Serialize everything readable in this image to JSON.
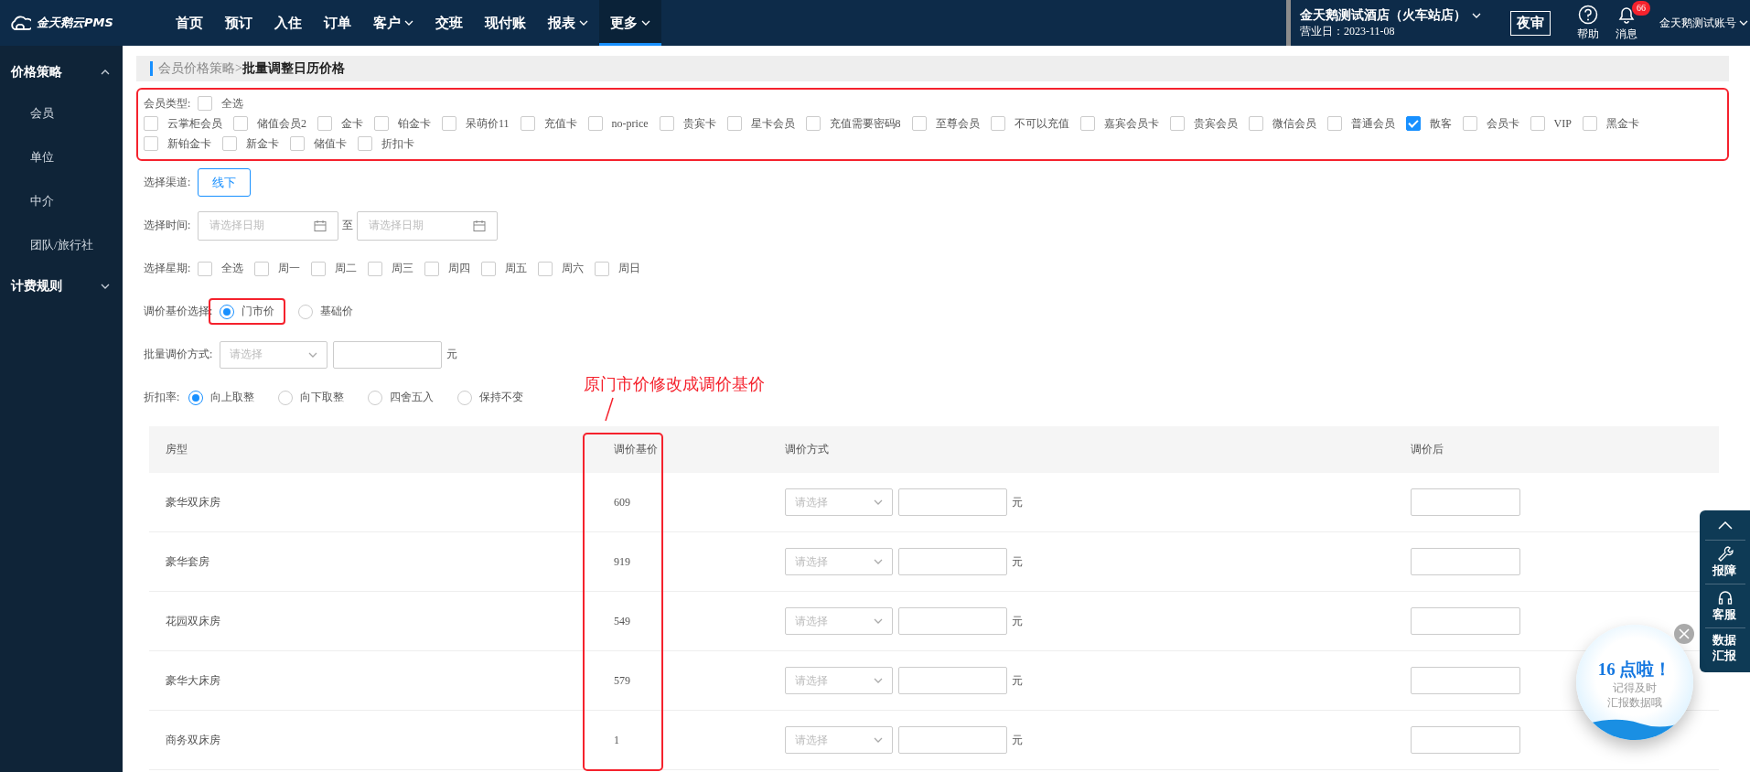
{
  "top_bar": {
    "logo": "金天鹅云PMS",
    "nav": [
      {
        "label": "首页",
        "dropdown": false,
        "selected": false
      },
      {
        "label": "预订",
        "dropdown": false,
        "selected": false
      },
      {
        "label": "入住",
        "dropdown": false,
        "selected": false
      },
      {
        "label": "订单",
        "dropdown": false,
        "selected": false
      },
      {
        "label": "客户",
        "dropdown": true,
        "selected": false
      },
      {
        "label": "交班",
        "dropdown": false,
        "selected": false
      },
      {
        "label": "现付账",
        "dropdown": false,
        "selected": false
      },
      {
        "label": "报表",
        "dropdown": true,
        "selected": false
      },
      {
        "label": "更多",
        "dropdown": true,
        "selected": true
      }
    ],
    "hotel": {
      "name": "金天鹅测试酒店（火车站店）",
      "business_date": "营业日：2023-11-08"
    },
    "night_audit": "夜审",
    "help": "帮助",
    "messages": {
      "label": "消息",
      "badge": "66"
    },
    "account": "金天鹅测试账号"
  },
  "sidebar": {
    "items": [
      {
        "label": "价格策略",
        "expanded": true,
        "children": [
          {
            "label": "会员"
          },
          {
            "label": "单位"
          },
          {
            "label": "中介"
          },
          {
            "label": "团队/旅行社"
          }
        ]
      },
      {
        "label": "计费规则",
        "expanded": false
      }
    ]
  },
  "breadcrumb": {
    "parent": "会员价格策略>",
    "current": "批量调整日历价格"
  },
  "member_types": {
    "label": "会员类型:",
    "highlighted": true,
    "select_all": {
      "label": "全选",
      "checked": false
    },
    "options": [
      {
        "label": "云掌柜会员",
        "checked": false
      },
      {
        "label": "储值会员2",
        "checked": false
      },
      {
        "label": "金卡",
        "checked": false
      },
      {
        "label": "铂金卡",
        "checked": false
      },
      {
        "label": "呆萌价11",
        "checked": false
      },
      {
        "label": "充值卡",
        "checked": false
      },
      {
        "label": "no-price",
        "checked": false
      },
      {
        "label": "贵宾卡",
        "checked": false
      },
      {
        "label": "星卡会员",
        "checked": false
      },
      {
        "label": "充值需要密码8",
        "checked": false
      },
      {
        "label": "至尊会员",
        "checked": false
      },
      {
        "label": "不可以充值",
        "checked": false
      },
      {
        "label": "嘉宾会员卡",
        "checked": false
      },
      {
        "label": "贵宾会员",
        "checked": false
      },
      {
        "label": "微信会员",
        "checked": false
      },
      {
        "label": "普通会员",
        "checked": false
      },
      {
        "label": "散客",
        "checked": true
      },
      {
        "label": "会员卡",
        "checked": false
      },
      {
        "label": "VIP",
        "checked": false
      },
      {
        "label": "黑金卡",
        "checked": false
      },
      {
        "label": "新铂金卡",
        "checked": false
      },
      {
        "label": "新金卡",
        "checked": false
      },
      {
        "label": "储值卡",
        "checked": false
      },
      {
        "label": "折扣卡",
        "checked": false
      }
    ]
  },
  "channel": {
    "label": "选择渠道:",
    "options": [
      {
        "label": "线下",
        "selected": true
      }
    ]
  },
  "time": {
    "label": "选择时间:",
    "start": {
      "placeholder": "请选择日期"
    },
    "separator": "至",
    "end": {
      "placeholder": "请选择日期"
    }
  },
  "weekdays": {
    "label": "选择星期:",
    "options": [
      {
        "label": "全选",
        "checked": false
      },
      {
        "label": "周一",
        "checked": false
      },
      {
        "label": "周二",
        "checked": false
      },
      {
        "label": "周三",
        "checked": false
      },
      {
        "label": "周四",
        "checked": false
      },
      {
        "label": "周五",
        "checked": false
      },
      {
        "label": "周六",
        "checked": false
      },
      {
        "label": "周日",
        "checked": false
      }
    ]
  },
  "base_price": {
    "label": "调价基价选择:",
    "options": [
      {
        "label": "门市价",
        "selected": true,
        "highlighted": true
      },
      {
        "label": "基础价",
        "selected": false,
        "highlighted": false
      }
    ]
  },
  "batch_method": {
    "label": "批量调价方式:",
    "select": {
      "placeholder": "请选择"
    },
    "unit": "元"
  },
  "rounding": {
    "label": "折扣率:",
    "options": [
      {
        "label": "向上取整",
        "selected": true
      },
      {
        "label": "向下取整",
        "selected": false
      },
      {
        "label": "四舍五入",
        "selected": false
      },
      {
        "label": "保持不变",
        "selected": false
      }
    ]
  },
  "annotation": {
    "text": "原门市价修改成调价基价"
  },
  "table": {
    "columns": [
      {
        "label": "房型",
        "highlighted": false
      },
      {
        "label": "调价基价",
        "highlighted": true
      },
      {
        "label": "调价方式",
        "highlighted": false
      },
      {
        "label": "调价后",
        "highlighted": false
      }
    ],
    "rows": [
      {
        "room_type": "豪华双床房",
        "base_price": "609",
        "method": {
          "placeholder": "请选择"
        },
        "unit": "元"
      },
      {
        "room_type": "豪华套房",
        "base_price": "919",
        "method": {
          "placeholder": "请选择"
        },
        "unit": "元"
      },
      {
        "room_type": "花园双床房",
        "base_price": "549",
        "method": {
          "placeholder": "请选择"
        },
        "unit": "元"
      },
      {
        "room_type": "豪华大床房",
        "base_price": "579",
        "method": {
          "placeholder": "请选择"
        },
        "unit": "元"
      },
      {
        "room_type": "商务双床房",
        "base_price": "1",
        "method": {
          "placeholder": "请选择"
        },
        "unit": "元"
      }
    ]
  },
  "float_toolbar": {
    "items": [
      {
        "kind": "top"
      },
      {
        "kind": "repair",
        "label": "报障"
      },
      {
        "kind": "service",
        "label": "客服"
      },
      {
        "kind": "report",
        "label": "数据汇报"
      }
    ]
  },
  "reminder": {
    "title": "16 点啦！",
    "lines": [
      "记得及时",
      "汇报数据哦"
    ]
  }
}
